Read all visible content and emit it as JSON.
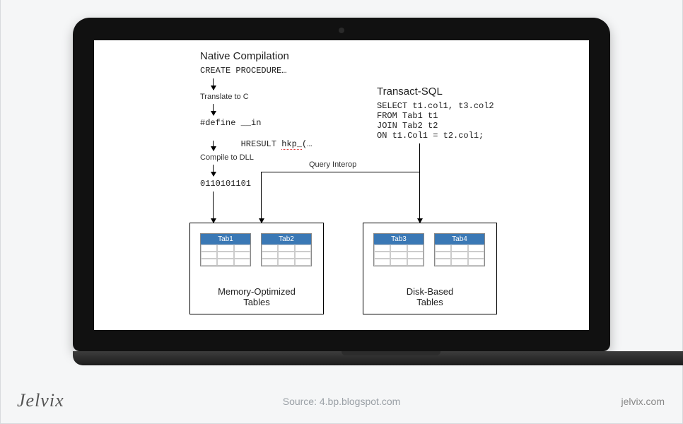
{
  "diagram": {
    "left": {
      "heading": "Native Compilation",
      "code1": "CREATE PROCEDURE…",
      "step1": "Translate to C",
      "code2_line1": "#define __in",
      "code2_line2a": "HRESULT ",
      "code2_line2b": "hkp_",
      "code2_line2c": "(…",
      "step2": "Compile to DLL",
      "binary": "0110101101"
    },
    "interop_label": "Query Interop",
    "right": {
      "heading": "Transact-SQL",
      "sql_line1": "SELECT t1.col1, t3.col2",
      "sql_line2": "FROM Tab1 t1",
      "sql_line3": "JOIN Tab2 t2",
      "sql_line4": "ON t1.Col1 = t2.col1;"
    },
    "groups": {
      "left_title_1": "Memory-Optimized",
      "left_title_2": "Tables",
      "right_title_1": "Disk-Based",
      "right_title_2": "Tables",
      "tab1": "Tab1",
      "tab2": "Tab2",
      "tab3": "Tab3",
      "tab4": "Tab4"
    }
  },
  "footer": {
    "brand": "Jelvix",
    "source": "Source: 4.bp.blogspot.com",
    "site": "jelvix.com"
  }
}
